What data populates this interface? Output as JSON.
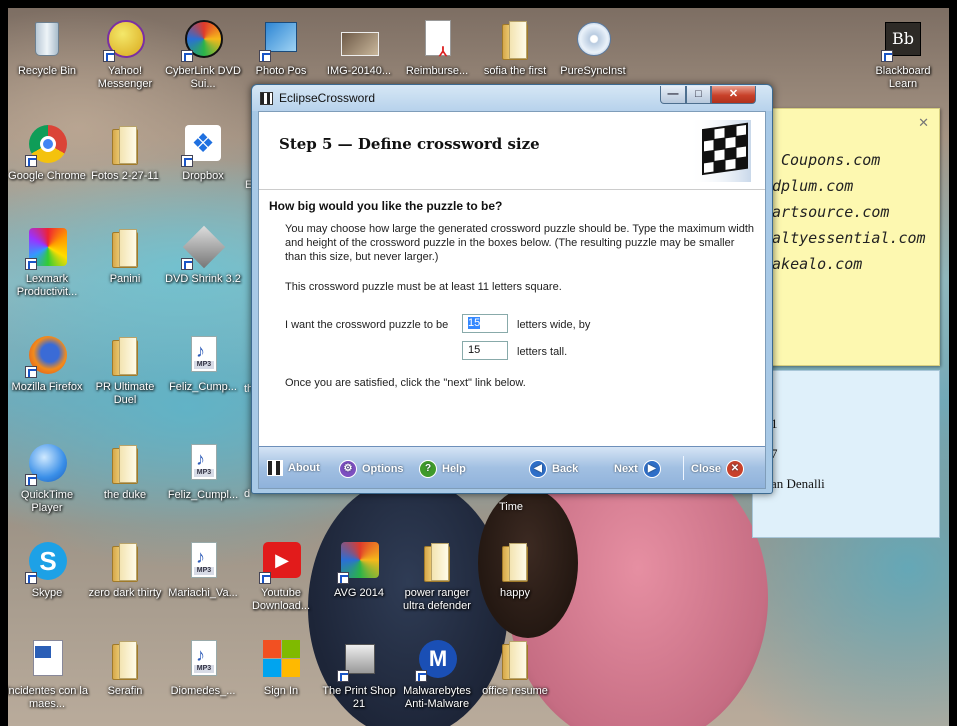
{
  "desktop_icons": [
    {
      "label": "Recycle Bin",
      "icon": "recycle-bin-icon"
    },
    {
      "label": "Yahoo! Messenger",
      "icon": "yahoo-messenger-icon"
    },
    {
      "label": "CyberLink DVD Sui...",
      "icon": "cyberlink-icon"
    },
    {
      "label": "Photo Pos",
      "icon": "photo-pos-icon"
    },
    {
      "label": "IMG-20140...",
      "icon": "image-file-icon"
    },
    {
      "label": "Reimburse...",
      "icon": "pdf-file-icon"
    },
    {
      "label": "sofia the first",
      "icon": "folder-icon"
    },
    {
      "label": "PureSyncInst",
      "icon": "installer-icon"
    },
    {
      "label": "Blackboard Learn",
      "icon": "blackboard-icon"
    },
    {
      "label": "Google Chrome",
      "icon": "chrome-icon"
    },
    {
      "label": "Fotos 2-27-11",
      "icon": "folder-icon"
    },
    {
      "label": "Dropbox",
      "icon": "dropbox-icon"
    },
    {
      "label": "Lexmark Productivit...",
      "icon": "lexmark-icon"
    },
    {
      "label": "Panini",
      "icon": "folder-icon"
    },
    {
      "label": "DVD Shrink 3.2",
      "icon": "dvd-shrink-icon"
    },
    {
      "label": "Mozilla Firefox",
      "icon": "firefox-icon"
    },
    {
      "label": "PR Ultimate Duel",
      "icon": "folder-icon"
    },
    {
      "label": "Feliz_Cump...",
      "icon": "mp3-icon"
    },
    {
      "label": "QuickTime Player",
      "icon": "quicktime-icon"
    },
    {
      "label": "the duke",
      "icon": "folder-icon"
    },
    {
      "label": "Feliz_Cumpl...",
      "icon": "mp3-icon"
    },
    {
      "label": "Skype",
      "icon": "skype-icon"
    },
    {
      "label": "zero dark thirty",
      "icon": "folder-icon"
    },
    {
      "label": "Mariachi_Va...",
      "icon": "mp3-icon"
    },
    {
      "label": "Youtube Download...",
      "icon": "youtube-downloader-icon"
    },
    {
      "label": "AVG 2014",
      "icon": "avg-icon"
    },
    {
      "label": "power ranger ultra defender",
      "icon": "folder-icon"
    },
    {
      "label": "happy",
      "icon": "folder-icon"
    },
    {
      "label": "incidentes con la maes...",
      "icon": "word-doc-icon"
    },
    {
      "label": "Serafin",
      "icon": "folder-icon"
    },
    {
      "label": "Diomedes_...",
      "icon": "mp3-icon"
    },
    {
      "label": "Sign In",
      "icon": "microsoft-icon"
    },
    {
      "label": "The Print Shop 21",
      "icon": "print-shop-icon"
    },
    {
      "label": "Malwarebytes Anti-Malware",
      "icon": "malwarebytes-icon"
    },
    {
      "label": "office resume",
      "icon": "folder-icon"
    }
  ],
  "partial_labels": {
    "behind_window_1": "E",
    "behind_window_2": "th",
    "behind_window_3": "d",
    "time_label": "Time"
  },
  "sticky_note": {
    "lines": [
      "Coupons.com",
      "edplum.com",
      "martsource.com",
      "ealtyessential.com",
      "hakealo.com"
    ]
  },
  "blue_note": {
    "lines": [
      "1",
      "7",
      "an Denalli"
    ]
  },
  "window": {
    "title": "EclipseCrossword",
    "step_title": "Step 5 — Define crossword size",
    "question": "How big would you like the puzzle to be?",
    "description": "You may choose how large the generated crossword puzzle should be.  Type the maximum width and height of the crossword puzzle in the boxes below.  (The resulting puzzle may be smaller than this size, but never larger.)",
    "minimum_note": "This crossword puzzle must be at least 11 letters square.",
    "size_prompt": "I want the crossword puzzle to be",
    "width_value": "15",
    "width_suffix": "letters wide, by",
    "height_value": "15",
    "height_suffix": "letters tall.",
    "instruction": "Once you are satisfied, click the \"next\" link below.",
    "footer": {
      "about": "About",
      "options": "Options",
      "help": "Help",
      "back": "Back",
      "next": "Next",
      "close": "Close"
    }
  },
  "colors": {
    "accent_blue": "#3a79c9",
    "close_red": "#c8412a",
    "sticky_yellow": "#fdf8b0"
  }
}
